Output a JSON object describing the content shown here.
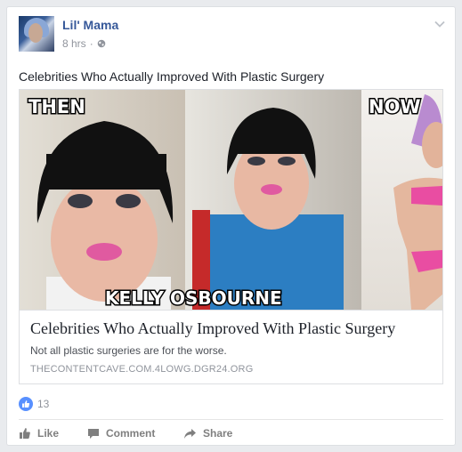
{
  "post": {
    "author": "Lil' Mama",
    "time": "8 hrs",
    "separator": "·",
    "text": "Celebrities Who Actually Improved With Plastic Surgery"
  },
  "link": {
    "image_labels": {
      "then": "THEN",
      "now": "NOW",
      "name": "KELLY OSBOURNE"
    },
    "title": "Celebrities Who Actually Improved With Plastic Surgery",
    "description": "Not all plastic surgeries are for the worse.",
    "domain": "THECONTENTCAVE.COM.4LOWG.DGR24.ORG"
  },
  "stats": {
    "reaction_icon": "like-icon",
    "like_count": "13"
  },
  "actions": {
    "like": "Like",
    "comment": "Comment",
    "share": "Share"
  },
  "colors": {
    "author_link": "#365899",
    "like_blue": "#5890ff",
    "muted": "#90949c",
    "background": "#e9ebee"
  },
  "icons": {
    "visibility": "globe-icon",
    "menu": "chevron-down-icon",
    "like_action": "thumbs-up-icon",
    "comment_action": "comment-bubble-icon",
    "share_action": "share-arrow-icon"
  }
}
